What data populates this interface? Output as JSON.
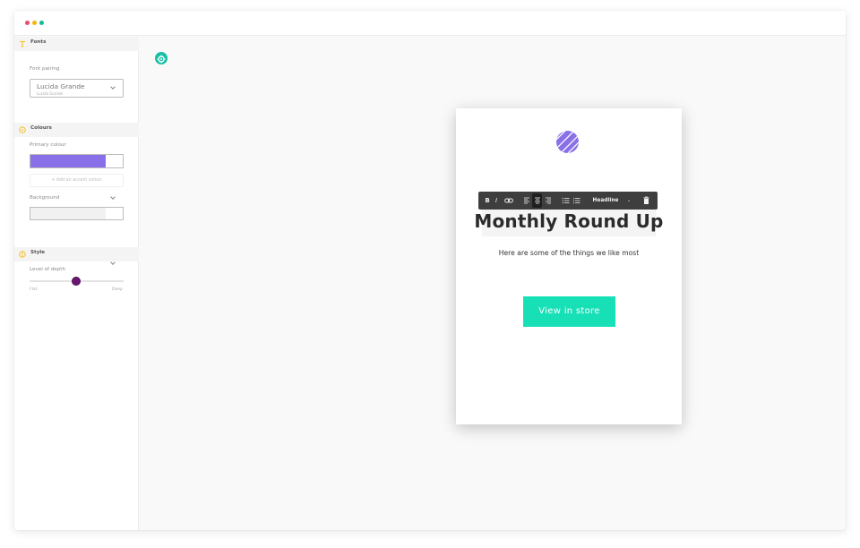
{
  "colors": {
    "dot_red": "#ef4a63",
    "dot_yellow": "#f5b40c",
    "dot_teal": "#16b89f",
    "primary": "#8a70e8",
    "accent_teal": "#17e0b7",
    "section_icon": "#f5c542",
    "knob": "#6a1672"
  },
  "sidebar": {
    "fonts": {
      "title": "Fonts",
      "icon": "font-t-icon",
      "pairing_label": "Font pairing",
      "pairing_value": "Lucida Grande",
      "pairing_sub": "Lucida Grande"
    },
    "colours": {
      "title": "Colours",
      "icon": "palette-icon",
      "primary_label": "Primary colour",
      "add_accent": "+ Add an accent colour",
      "background_label": "Background"
    },
    "style": {
      "title": "Style",
      "icon": "sun-icon",
      "depth_label": "Level of depth",
      "min_label": "Flat",
      "max_label": "Deep",
      "depth_value": 0.5
    }
  },
  "toolbar": {
    "bold": "B",
    "italic": "I",
    "link_icon": "link-icon",
    "align_left_icon": "align-left-icon",
    "align_center_icon": "align-center-icon",
    "align_right_icon": "align-right-icon",
    "bullet_list_icon": "bullet-list-icon",
    "numbered_list_icon": "numbered-list-icon",
    "style_value": "Headline",
    "delete_icon": "trash-icon"
  },
  "email": {
    "logo": "striped-circle-logo",
    "headline": "Monthly Round Up",
    "subtext": "Here are some of the things we like most",
    "cta": "View in store"
  }
}
